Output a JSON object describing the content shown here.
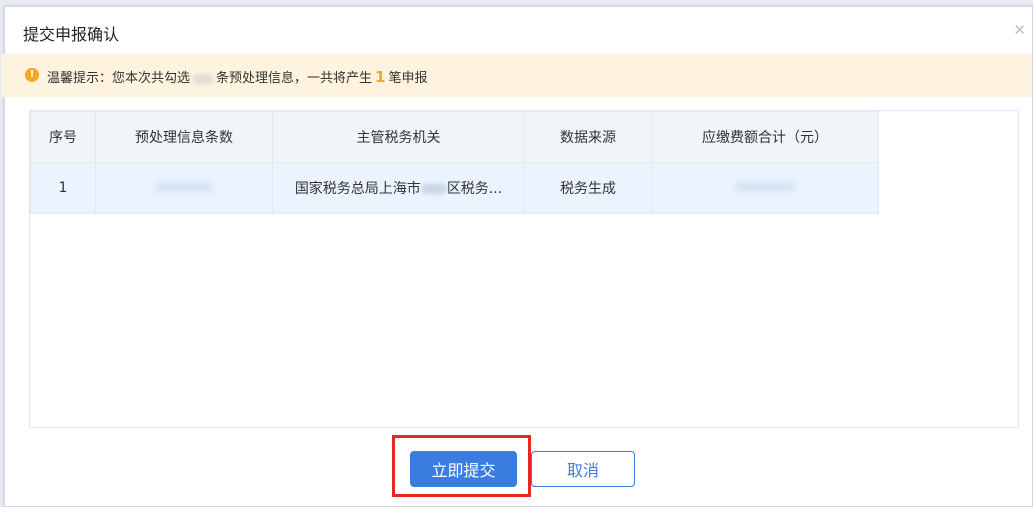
{
  "dialog": {
    "title": "提交申报确认"
  },
  "notice": {
    "prefix": "温馨提示：您本次共勾选",
    "middle": "条预处理信息，一共将产生",
    "count": "1",
    "suffix": "笔申报",
    "icon": "info-icon"
  },
  "table": {
    "headers": [
      "序号",
      "预处理信息条数",
      "主管税务机关",
      "数据来源",
      "应缴费额合计（元）"
    ],
    "rows": [
      {
        "index": "1",
        "authority_prefix": "国家税务总局上海市",
        "authority_suffix": "区税务...",
        "source": "税务生成"
      }
    ]
  },
  "buttons": {
    "submit": "立即提交",
    "cancel": "取消"
  },
  "colors": {
    "primary": "#3a7de0",
    "warning": "#f5a623",
    "highlight": "#e8281e"
  }
}
